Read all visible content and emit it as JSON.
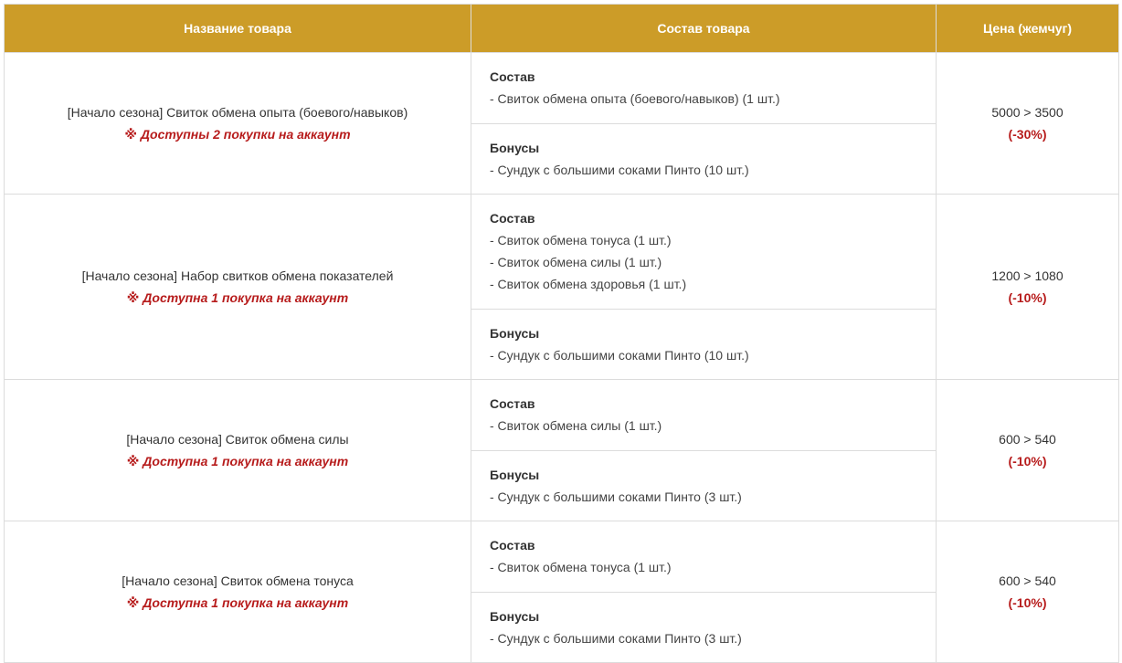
{
  "colors": {
    "header_bg": "#cc9c28",
    "accent_red": "#b71c1c",
    "border": "#dcdcdc"
  },
  "headers": {
    "name": "Название товара",
    "composition": "Состав товара",
    "price": "Цена (жемчуг)"
  },
  "rows": [
    {
      "name": "[Начало сезона] Свиток обмена опыта (боевого/навыков)",
      "limit": "※ Доступны 2 покупки на аккаунт",
      "sections": [
        {
          "title": "Состав",
          "items": [
            "- Свиток обмена опыта (боевого/навыков) (1 шт.)"
          ]
        },
        {
          "title": "Бонусы",
          "items": [
            "- Сундук с большими соками Пинто (10 шт.)"
          ]
        }
      ],
      "price": "5000 > 3500",
      "discount": "(-30%)"
    },
    {
      "name": "[Начало сезона] Набор свитков обмена показателей",
      "limit": "※ Доступна 1 покупка на аккаунт",
      "sections": [
        {
          "title": "Состав",
          "items": [
            "- Свиток обмена тонуса (1 шт.)",
            "- Свиток обмена силы (1 шт.)",
            "- Свиток обмена здоровья (1 шт.)"
          ]
        },
        {
          "title": "Бонусы",
          "items": [
            "- Сундук с большими соками Пинто (10 шт.)"
          ]
        }
      ],
      "price": "1200 > 1080",
      "discount": "(-10%)"
    },
    {
      "name": "[Начало сезона] Свиток обмена силы",
      "limit": "※ Доступна 1 покупка на аккаунт",
      "sections": [
        {
          "title": "Состав",
          "items": [
            "- Свиток обмена силы (1 шт.)"
          ]
        },
        {
          "title": "Бонусы",
          "items": [
            "- Сундук с большими соками Пинто (3 шт.)"
          ]
        }
      ],
      "price": "600 > 540",
      "discount": "(-10%)"
    },
    {
      "name": "[Начало сезона] Свиток обмена тонуса",
      "limit": "※ Доступна 1 покупка на аккаунт",
      "sections": [
        {
          "title": "Состав",
          "items": [
            "- Свиток обмена тонуса (1 шт.)"
          ]
        },
        {
          "title": "Бонусы",
          "items": [
            "- Сундук с большими соками Пинто (3 шт.)"
          ]
        }
      ],
      "price": "600 > 540",
      "discount": "(-10%)"
    }
  ]
}
